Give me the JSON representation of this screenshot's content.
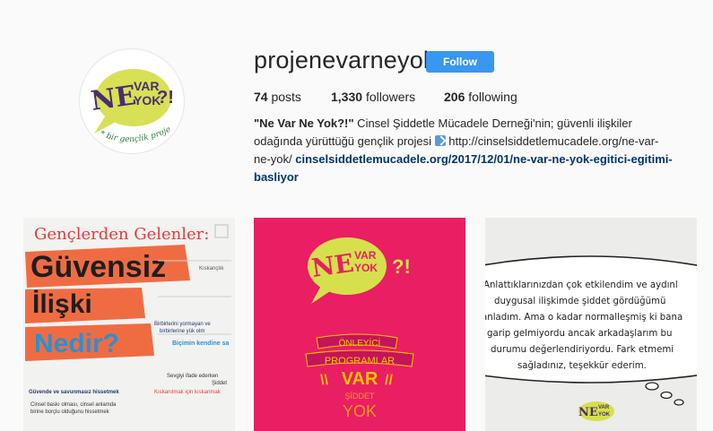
{
  "profile": {
    "username": "projenevarneyok",
    "follow_label": "Follow",
    "stats": {
      "posts_count": "74",
      "posts_label": "posts",
      "followers_count": "1,330",
      "followers_label": "followers",
      "following_count": "206",
      "following_label": "following"
    },
    "bio": {
      "name": "\"Ne Var Ne Yok?!\"",
      "text": " Cinsel Şiddetle Mücadele Derneği'nin; güvenli ilişkiler odağında yürüttüğü gençlik projesi ",
      "url_text": " http://cinselsiddetlemucadele.org/ne-var-ne-yok/ ",
      "link": "cinselsiddetlemucadele.org/2017/12/01/ne-var-ne-yok-egitici-egitimi-basliyor",
      "link_icon": "check-mark-button-icon"
    },
    "avatar_logo": {
      "ne": "NE",
      "var": "VAR",
      "yok": "YOK",
      "punct": "?!",
      "tagline": "* bir gençlik projesi"
    }
  },
  "posts": [
    {
      "title": "Gençlerden Gelenler:",
      "headline_1": "Güvensiz",
      "headline_2": "İlişki",
      "headline_3": "Nedir?",
      "notes": [
        "Kıskançlık",
        "Birbirlerini yormayan ve",
        "birbirlerine yük olm",
        "Biçimin kendine sa",
        "Güvende ve savunmasız hissetmek",
        "Cinsel baskı olması, cinsel anlamda",
        "birine borçlu olduğunu hissetmek",
        "Şiddet",
        "Sevgiyi ifade ederken",
        "Kıskanılmak için kıskanmak"
      ],
      "colors": {
        "orange": "#ef6c43",
        "blue": "#2d8fd0",
        "red": "#e53a3a",
        "navy": "#1e3a6b"
      }
    },
    {
      "logo_ne": "NE",
      "logo_var": "VAR",
      "logo_yok": "YOK",
      "logo_punct": "?!",
      "line_1": "ÖNLEYİCİ",
      "line_2": "PROGRAMLAR",
      "line_3": "VAR",
      "line_4": "ŞİDDET",
      "line_5": "YOK",
      "colors": {
        "bg": "#e91e63",
        "lime": "#d6e04c",
        "yellow": "#f5c400"
      }
    },
    {
      "quote_lines": [
        "Anlattıklarınızdan çok etkilendim ve aydınl",
        "duygusal ilişkimde şiddet gördüğümü",
        "anladım. Ama o kadar normalleşmiş ki bana",
        "garip gelmiyordu ancak arkadaşlarım bu",
        "durumu değerlendiriyordu. Fark etmemi",
        "sağladınız, teşekkür ederim."
      ],
      "logo_ne": "NE",
      "logo_var": "VAR",
      "logo_yok": "YOK"
    }
  ]
}
